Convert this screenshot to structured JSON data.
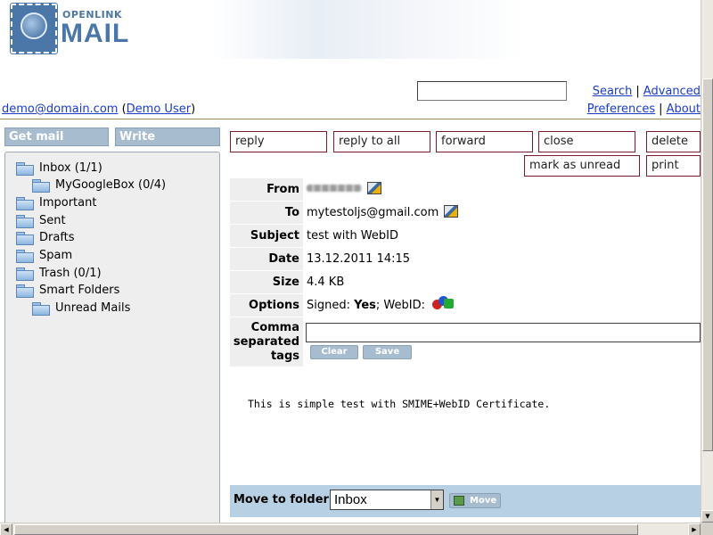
{
  "logo": {
    "small": "OPENLINK",
    "big": "MAIL"
  },
  "header": {
    "search_link": "Search",
    "advanced_link": "Advanced",
    "preferences_link": "Preferences",
    "about_link": "About",
    "separator": "|"
  },
  "user": {
    "email": "demo@domain.com",
    "name": "Demo User",
    "open_paren": "(",
    "close_paren": ")"
  },
  "sidebar": {
    "get_mail": "Get mail",
    "write": "Write",
    "folders": [
      {
        "label": "Inbox (1/1)"
      },
      {
        "label": "MyGoogleBox (0/4)"
      },
      {
        "label": "Important"
      },
      {
        "label": "Sent"
      },
      {
        "label": "Drafts"
      },
      {
        "label": "Spam"
      },
      {
        "label": "Trash (0/1)"
      },
      {
        "label": "Smart Folders"
      },
      {
        "label": "Unread Mails"
      }
    ]
  },
  "actions": {
    "reply": "reply",
    "reply_all": "reply to all",
    "forward": "forward",
    "close": "close",
    "delete": "delete",
    "mark_unread": "mark as unread",
    "print": "print"
  },
  "message": {
    "from_label": "From",
    "to_label": "To",
    "to_value": "mytestoljs@gmail.com",
    "subject_label": "Subject",
    "subject_value": "test with WebID",
    "date_label": "Date",
    "date_value": "13.12.2011 14:15",
    "size_label": "Size",
    "size_value": "4.4 KB",
    "options_label": "Options",
    "signed_label": "Signed:",
    "signed_value": "Yes",
    "webid_label": "; WebID:",
    "tags_label_1": "Comma",
    "tags_label_2": "separated",
    "tags_label_3": "tags",
    "clear_button": "Clear",
    "save_button": "Save",
    "body": "This is simple test with SMIME+WebID Certificate."
  },
  "move": {
    "label": "Move to folder",
    "selected": "Inbox",
    "button": "Move"
  }
}
